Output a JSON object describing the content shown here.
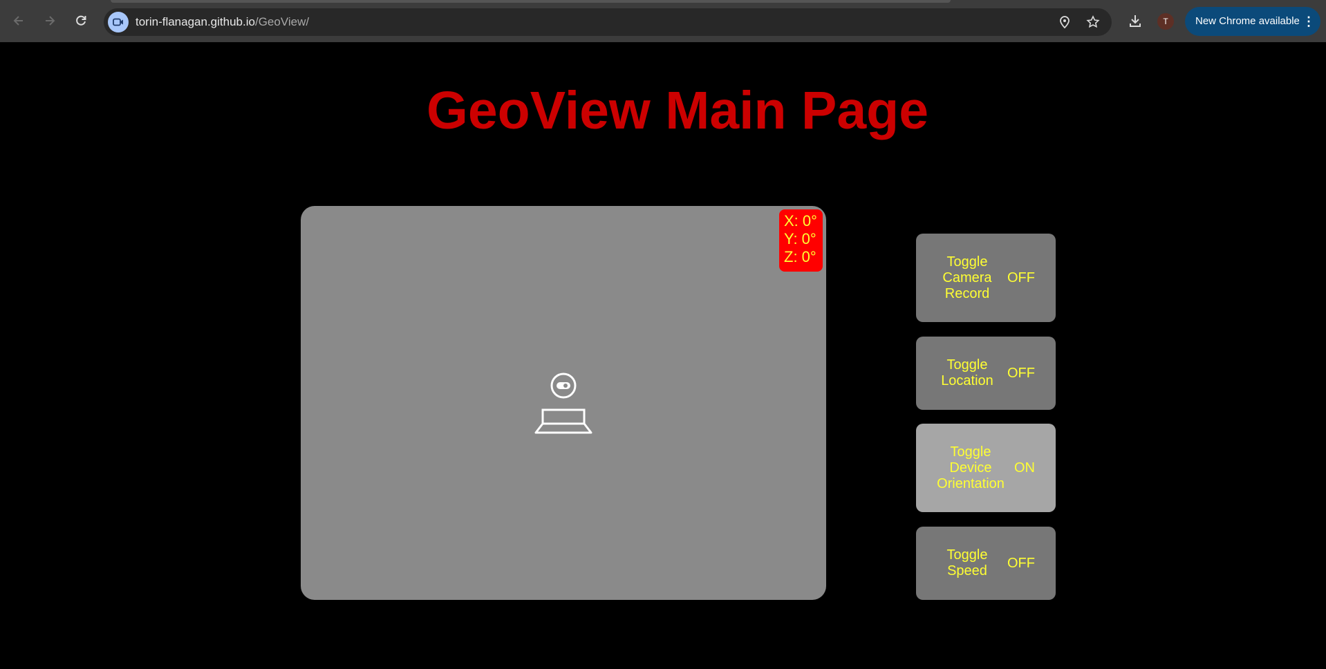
{
  "browser": {
    "url_host": "torin-flanagan.github.io",
    "url_path": "/GeoView/",
    "profile_initial": "T",
    "update_label": "New Chrome available"
  },
  "page": {
    "title": "GeoView Main Page",
    "orientation": {
      "x": "X: 0°",
      "y": "Y: 0°",
      "z": "Z: 0°"
    },
    "toggles": [
      {
        "label_lines": [
          "Toggle",
          "Camera",
          "Record"
        ],
        "state": "OFF",
        "active": false
      },
      {
        "label_lines": [
          "Toggle",
          "Location"
        ],
        "state": "OFF",
        "active": false
      },
      {
        "label_lines": [
          "Toggle",
          "Device",
          "Orientation"
        ],
        "state": "ON",
        "active": true
      },
      {
        "label_lines": [
          "Toggle",
          "Speed"
        ],
        "state": "OFF",
        "active": false
      }
    ]
  },
  "colors": {
    "title": "#cc0000",
    "button_text": "#ffff33",
    "badge_bg": "#ff0000",
    "panel_bg": "#8a8a8a",
    "button_off_bg": "#777777",
    "button_on_bg": "#a6a6a6"
  },
  "icons": {
    "camera_placeholder": "webcam-icon"
  }
}
